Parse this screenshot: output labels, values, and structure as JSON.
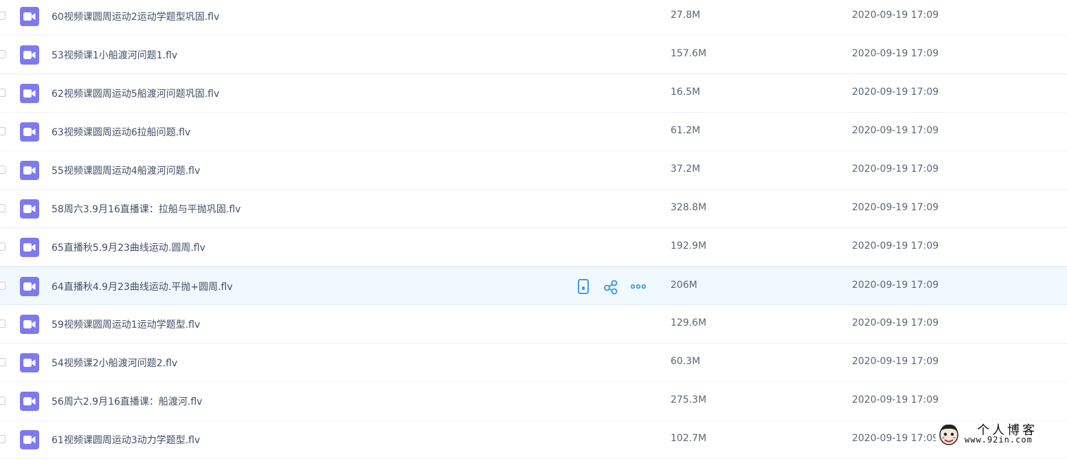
{
  "files": [
    {
      "name": "60视频课圆周运动2运动学题型巩固.flv",
      "size": "27.8M",
      "date": "2020-09-19 17:09"
    },
    {
      "name": "53视频课1小船渡河问题1.flv",
      "size": "157.6M",
      "date": "2020-09-19 17:09"
    },
    {
      "name": "62视频课圆周运动5船渡河问题巩固.flv",
      "size": "16.5M",
      "date": "2020-09-19 17:09"
    },
    {
      "name": "63视频课圆周运动6拉船问题.flv",
      "size": "61.2M",
      "date": "2020-09-19 17:09"
    },
    {
      "name": "55视频课圆周运动4船渡河问题.flv",
      "size": "37.2M",
      "date": "2020-09-19 17:09"
    },
    {
      "name": "58周六3.9月16直播课：拉船与平抛巩固.flv",
      "size": "328.8M",
      "date": "2020-09-19 17:09"
    },
    {
      "name": "65直播秋5.9月23曲线运动.圆周.flv",
      "size": "192.9M",
      "date": "2020-09-19 17:09"
    },
    {
      "name": "64直播秋4.9月23曲线运动.平抛+圆周.flv",
      "size": "206M",
      "date": "2020-09-19 17:09"
    },
    {
      "name": "59视频课圆周运动1运动学题型.flv",
      "size": "129.6M",
      "date": "2020-09-19 17:09"
    },
    {
      "name": "54视频课2小船渡河问题2.flv",
      "size": "60.3M",
      "date": "2020-09-19 17:09"
    },
    {
      "name": "56周六2.9月16直播课：船渡河.flv",
      "size": "275.3M",
      "date": "2020-09-19 17:09"
    },
    {
      "name": "61视频课圆周运动3动力学题型.flv",
      "size": "102.7M",
      "date": "2020-09-19 17:09"
    }
  ],
  "hover_row_index": 7,
  "row_actions": [
    {
      "icon": "phone-icon"
    },
    {
      "icon": "share-icon"
    },
    {
      "icon": "more-icon"
    }
  ],
  "watermark": {
    "title": "个人博客",
    "url": "www.92in.com"
  },
  "colors": {
    "video_icon": "#7d79f0",
    "action_icon": "#3b9de9",
    "hover_row": "#f2f9fe"
  }
}
